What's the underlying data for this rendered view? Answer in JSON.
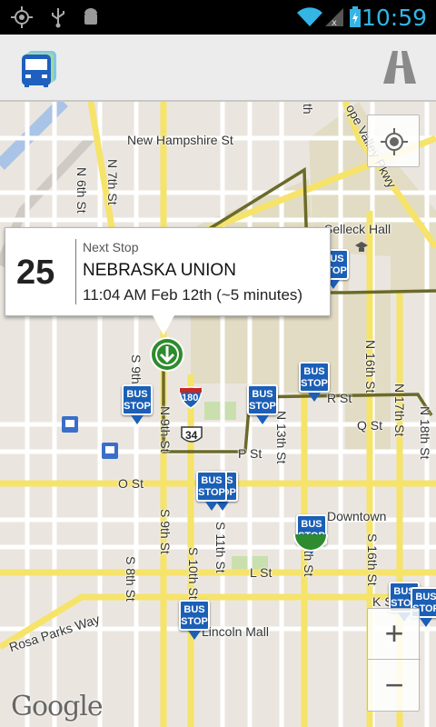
{
  "status_bar": {
    "time": "10:59",
    "icons": [
      "gps-icon",
      "usb-icon",
      "android-debug-icon",
      "wifi-icon",
      "no-signal-icon",
      "battery-charging-icon"
    ]
  },
  "action_bar": {
    "app_icon": "bus-app-icon",
    "route_icon": "road-icon"
  },
  "callout": {
    "route_number": "25",
    "label": "Next Stop",
    "stop_name": "NEBRASKA UNION",
    "eta": "11:04 AM Feb 12th (~5 minutes)"
  },
  "map": {
    "streets": {
      "new_hampshire": "New Hampshire St",
      "n7th": "N 7th St",
      "n6th": "N 6th St",
      "n9th": "N 9th St",
      "n13th": "N 13th St",
      "n16th": "N 16th St",
      "n17th": "N 17th St",
      "n18th": "N 18th St",
      "s9th": "S 9th St",
      "s8th": "S 8th St",
      "s10th": "S 10th St",
      "s11th": "S 11th St",
      "s13th": "13th St",
      "s16th": "S 16th St",
      "top_th": "th",
      "antelope": "ope Valley Pkwy",
      "r_st": "R St",
      "q_st": "Q St",
      "p_st": "P St",
      "o_st": "O St",
      "l_st": "L St",
      "k_st": "K St",
      "rosa_parks": "Rosa Parks Way",
      "lincoln_mall": "Lincoln Mall",
      "downtown": "Downtown",
      "selleck": "Selleck Hall",
      "h180": "180",
      "h34": "34"
    },
    "bus_stop_label_1": "BUS",
    "bus_stop_label_2": "STOP",
    "google": "Google",
    "zoom_in": "+",
    "zoom_out": "−",
    "colors": {
      "route_line": "#6b6a2a",
      "bus_stop": "#1b5fb6",
      "campus": "#e2dcc4",
      "road_yellow": "#f6e36a",
      "marker_green": "#2e8b2e"
    }
  }
}
